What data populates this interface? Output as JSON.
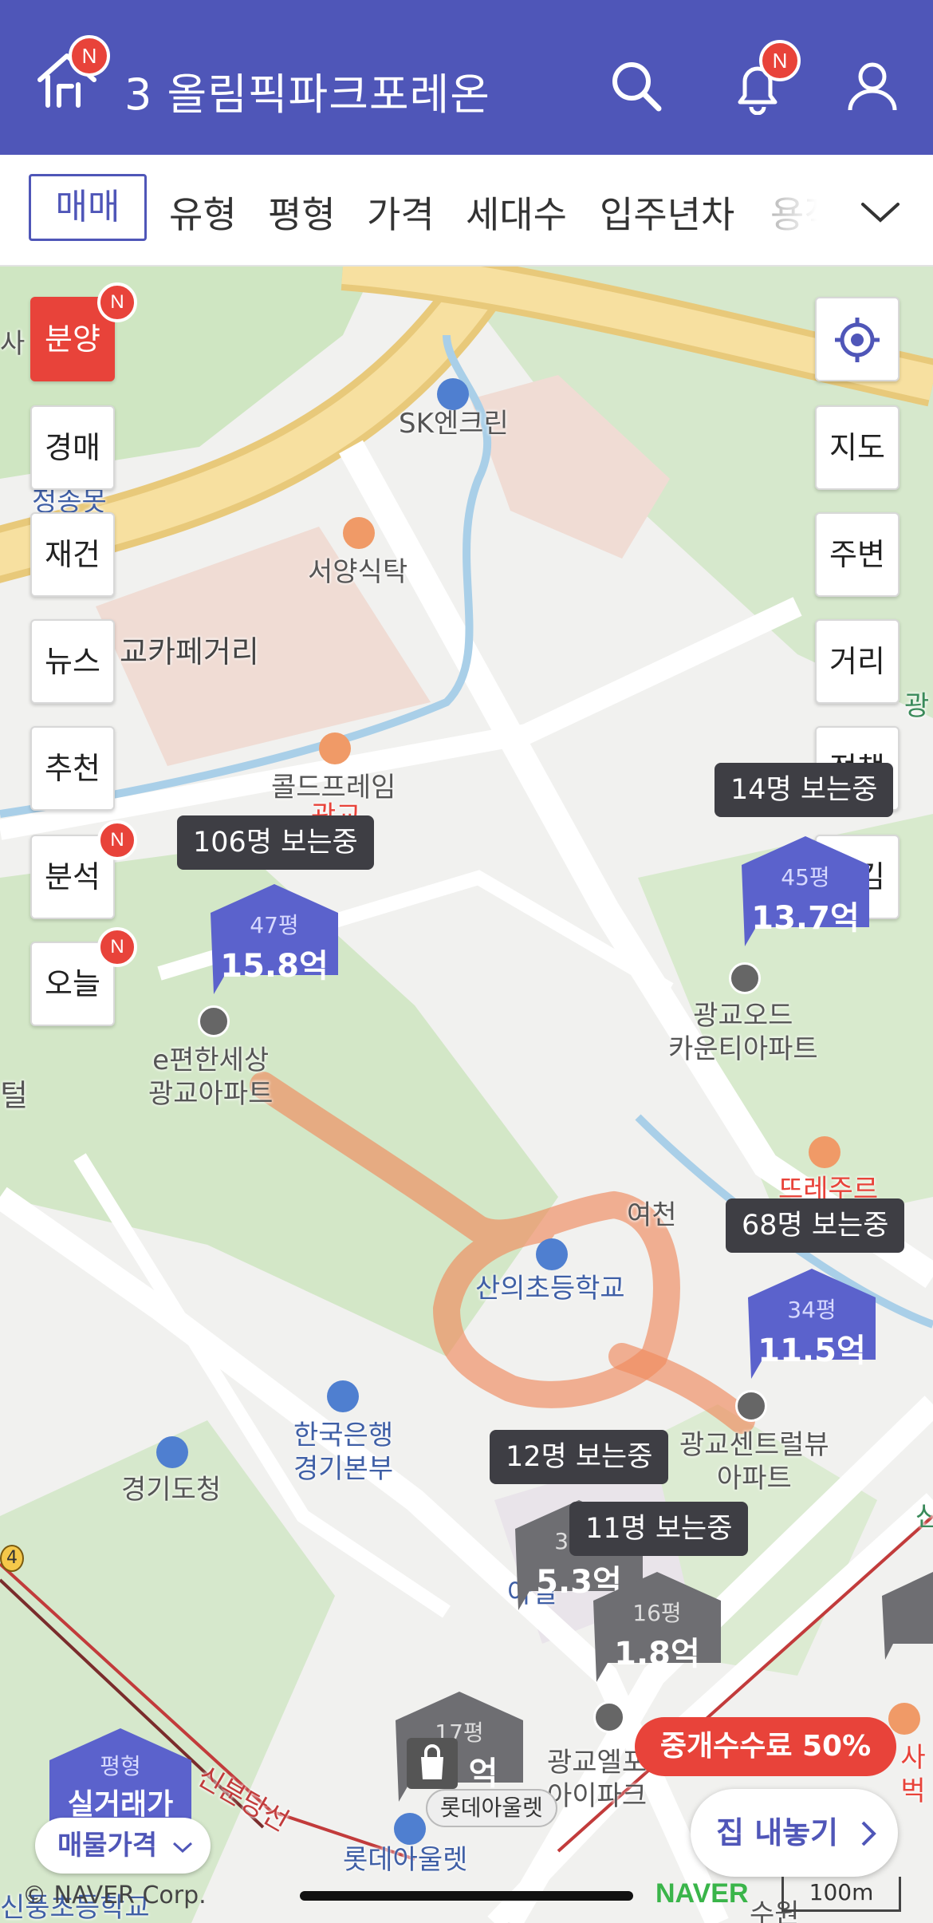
{
  "topbar": {
    "logo_badge": "N",
    "title": "3 올림픽파크포레온",
    "bell_badge": "N",
    "icons": [
      "home-logo-icon",
      "search-icon",
      "bell-icon",
      "user-icon"
    ]
  },
  "filters": {
    "active": "매매",
    "items": [
      "유형",
      "평형",
      "가격",
      "세대수",
      "입주년차",
      "용적"
    ]
  },
  "left_buttons": [
    {
      "label": "분양",
      "badge": "N"
    },
    {
      "label": "경매",
      "badge": ""
    },
    {
      "label": "재건",
      "badge": ""
    },
    {
      "label": "뉴스",
      "badge": ""
    },
    {
      "label": "추천",
      "badge": ""
    },
    {
      "label": "분석",
      "badge": "N"
    },
    {
      "label": "오늘",
      "badge": "N"
    }
  ],
  "right_buttons": [
    "지도",
    "주변",
    "거리",
    "정책",
    "숨김"
  ],
  "map_labels": {
    "sk": "SK엔크린",
    "western": "서양식탁",
    "cafe_street": "교카페거리",
    "coldframe": "콜드프레임",
    "coldframe2": "광교",
    "epyeonhan": [
      "e편한세상",
      "광교아파트"
    ],
    "odd": [
      "광교오드",
      "카운티아파트"
    ],
    "ttoreju": "뜨레주르",
    "river": "여천",
    "school": "산의초등학교",
    "bank": [
      "한국은행",
      "경기본부"
    ],
    "provincial": "경기도청",
    "central": [
      "광교센트럴뷰",
      "아파트"
    ],
    "ipark": [
      "광교엘포",
      "아이파크"
    ],
    "lotte": "롯데아울렛",
    "lotte_tag": "롯데아울렛",
    "line": "신분당선",
    "left_edge1": "사",
    "left_edge2": "정송못",
    "left_edge3": "털",
    "right_edge": "광",
    "right_edge2": "산",
    "right_edge3": "사벅",
    "bottom_school": "신풍초등학교",
    "bottom_right": "수원",
    "olive": "아일",
    "station_num": "4"
  },
  "markers": [
    {
      "viewers": "106명 보는중",
      "size": "47평",
      "price": "15.8억"
    },
    {
      "viewers": "14명 보는중",
      "size": "45평",
      "price": "13.7억"
    },
    {
      "viewers": "68명 보는중",
      "size": "34평",
      "price": "11.5억"
    },
    {
      "viewers": "12명 보는중",
      "size": "35평",
      "price": "5.3억"
    },
    {
      "viewers": "11명 보는중",
      "size": "16평",
      "price": "1.8억"
    },
    {
      "viewers": "",
      "size": "17평",
      "price": "억"
    }
  ],
  "bottom": {
    "mode_size": "평형",
    "mode_label": "실거래가",
    "listing_price": "매물가격",
    "fee_banner": "중개수수료 50%",
    "list_home": "집 내놓기",
    "copyright": "© NAVER Corp.",
    "naver": "NAVER",
    "scale": "100m"
  },
  "colors": {
    "brand": "#4f56b8",
    "badge": "#e8433a",
    "viewer_tag": "#3e3e44",
    "route": "#f08a5d"
  }
}
